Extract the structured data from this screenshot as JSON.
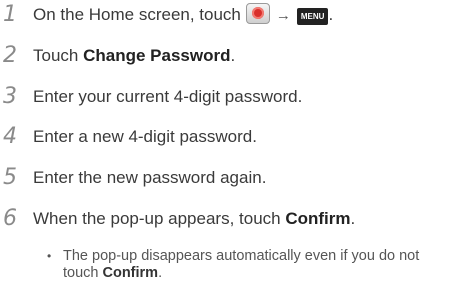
{
  "steps": [
    {
      "number": "1",
      "prefix": "On the Home screen, touch",
      "arrow": "→",
      "menu_key": "MENU",
      "suffix": "."
    },
    {
      "number": "2",
      "prefix": "Touch ",
      "bold": "Change Password",
      "suffix": "."
    },
    {
      "number": "3",
      "text": "Enter your current 4-digit password."
    },
    {
      "number": "4",
      "text": "Enter a new 4-digit password."
    },
    {
      "number": "5",
      "text": "Enter the new password again."
    },
    {
      "number": "6",
      "prefix": "When the pop-up appears, touch ",
      "bold": "Confirm",
      "suffix": "."
    }
  ],
  "note": {
    "bullet": "•",
    "line1": "The pop-up disappears automatically even if you do not",
    "line2_prefix": "touch ",
    "line2_bold": "Confirm",
    "line2_suffix": "."
  },
  "icons": {
    "app_icon": "red-circle-app-icon",
    "menu_key": "menu-key-icon"
  }
}
